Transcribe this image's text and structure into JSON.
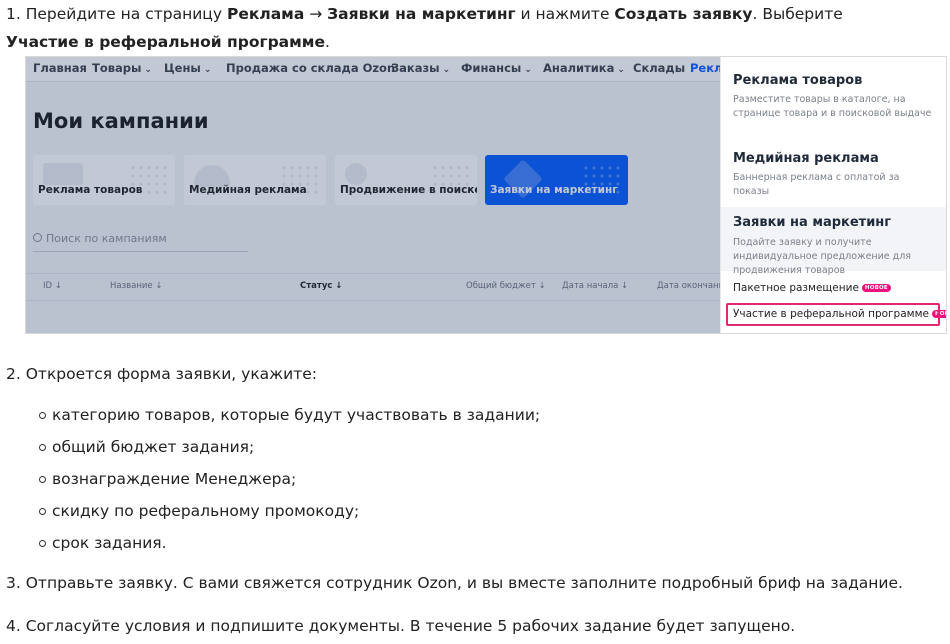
{
  "steps": {
    "s1": {
      "num": "1.",
      "t1": " Перейдите на страницу ",
      "b1": "Реклама",
      "arrow": " → ",
      "b2": "Заявки на маркетинг",
      "t2": " и нажмите ",
      "b3": "Создать заявку",
      "t3": ". Выберите ",
      "b4": "Участие в реферальной программе",
      "t4": "."
    },
    "s2": "2. Откроется форма заявки, укажите:",
    "s2_items": [
      "категорию товаров, которые будут участвовать в задании;",
      "общий бюджет задания;",
      "вознаграждение Менеджера;",
      "скидку по реферальному промокоду;",
      "срок задания."
    ],
    "s3": "3. Отправьте заявку. С вами свяжется сотрудник Ozon, и вы вместе заполните подробный бриф на задание.",
    "s4": "4. Согласуйте условия и подпишите документы. В течение 5 рабочих задание будет запущено."
  },
  "shot": {
    "nav": [
      "Главная",
      "Товары",
      "Цены",
      "Продажа со склада Ozon",
      "Заказы",
      "Финансы",
      "Аналитика",
      "Склады",
      "Рекл"
    ],
    "title": "Мои кампании",
    "cards": [
      "Реклама товаров",
      "Медийная реклама",
      "Продвижение в поиске",
      "Заявки на маркетинг"
    ],
    "search_placeholder": "Поиск по кампаниям",
    "columns": [
      "ID",
      "Название",
      "Статус",
      "Общий бюджет",
      "Дата начала",
      "Дата окончания"
    ],
    "menu": {
      "item1_title": "Реклама товаров",
      "item1_desc": "Разместите товары в каталоге, на странице товара и в поисковой выдаче",
      "item2_title": "Медийная реклама",
      "item2_desc": "Баннерная реклама с оплатой за показы",
      "item3_title": "Заявки на маркетинг",
      "item3_desc": "Подайте заявку и получите индивидуальное предложение для продвижения товаров",
      "link1": "Пакетное размещение",
      "link2": "Участие в реферальной программе",
      "badge": "НОВОЕ"
    }
  },
  "colors": {
    "accent": "#005bff",
    "badge": "#f1117e",
    "highlight_border": "#e0276f"
  }
}
